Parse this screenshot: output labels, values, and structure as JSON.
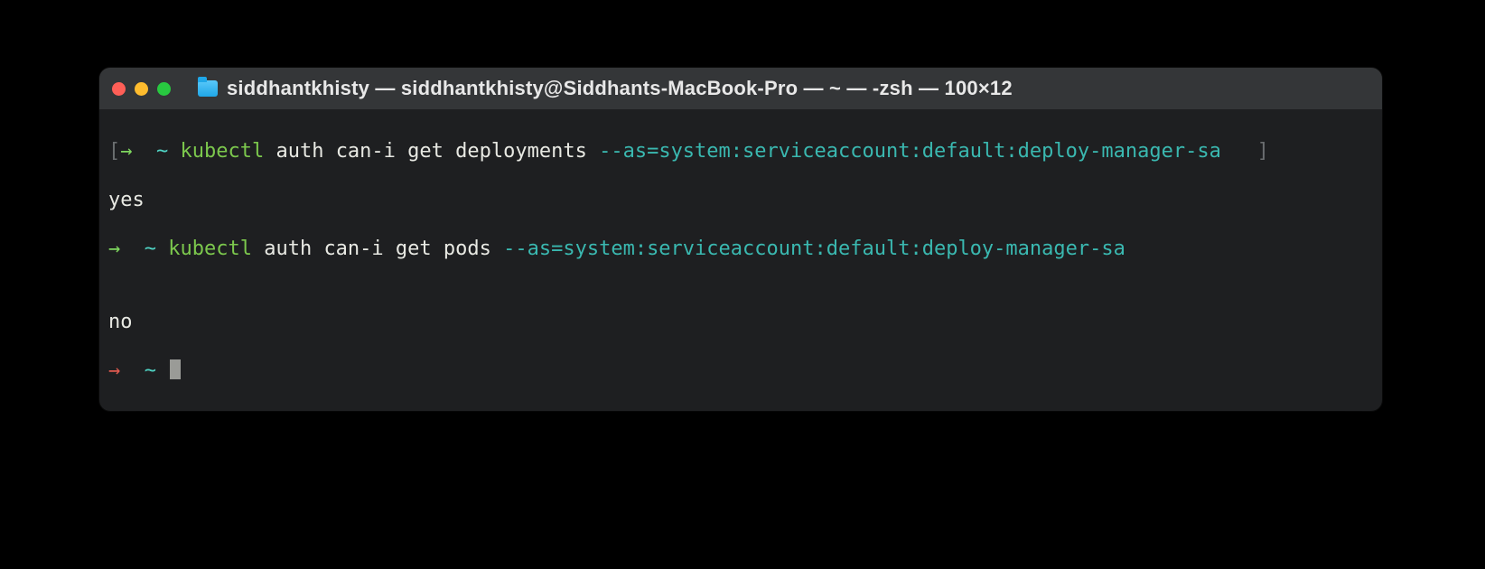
{
  "window": {
    "title": "siddhantkhisty — siddhantkhisty@Siddhants-MacBook-Pro — ~ — -zsh — 100×12"
  },
  "lines": {
    "l1": {
      "open_bracket": "[",
      "arrow": "→",
      "tilde": "~",
      "cmd": "kubectl",
      "rest": " auth can-i get deployments ",
      "flag": "--as=system:serviceaccount:default:deploy-manager-sa",
      "close_bracket": "]"
    },
    "l2": {
      "output": "yes"
    },
    "l3": {
      "arrow": "→",
      "tilde": "~",
      "cmd": "kubectl",
      "rest": " auth can-i get pods ",
      "flag": "--as=system:serviceaccount:default:deploy-manager-sa"
    },
    "l4": {
      "output": ""
    },
    "l5": {
      "output": "no"
    },
    "l6": {
      "arrow": "→",
      "tilde": "~"
    }
  }
}
